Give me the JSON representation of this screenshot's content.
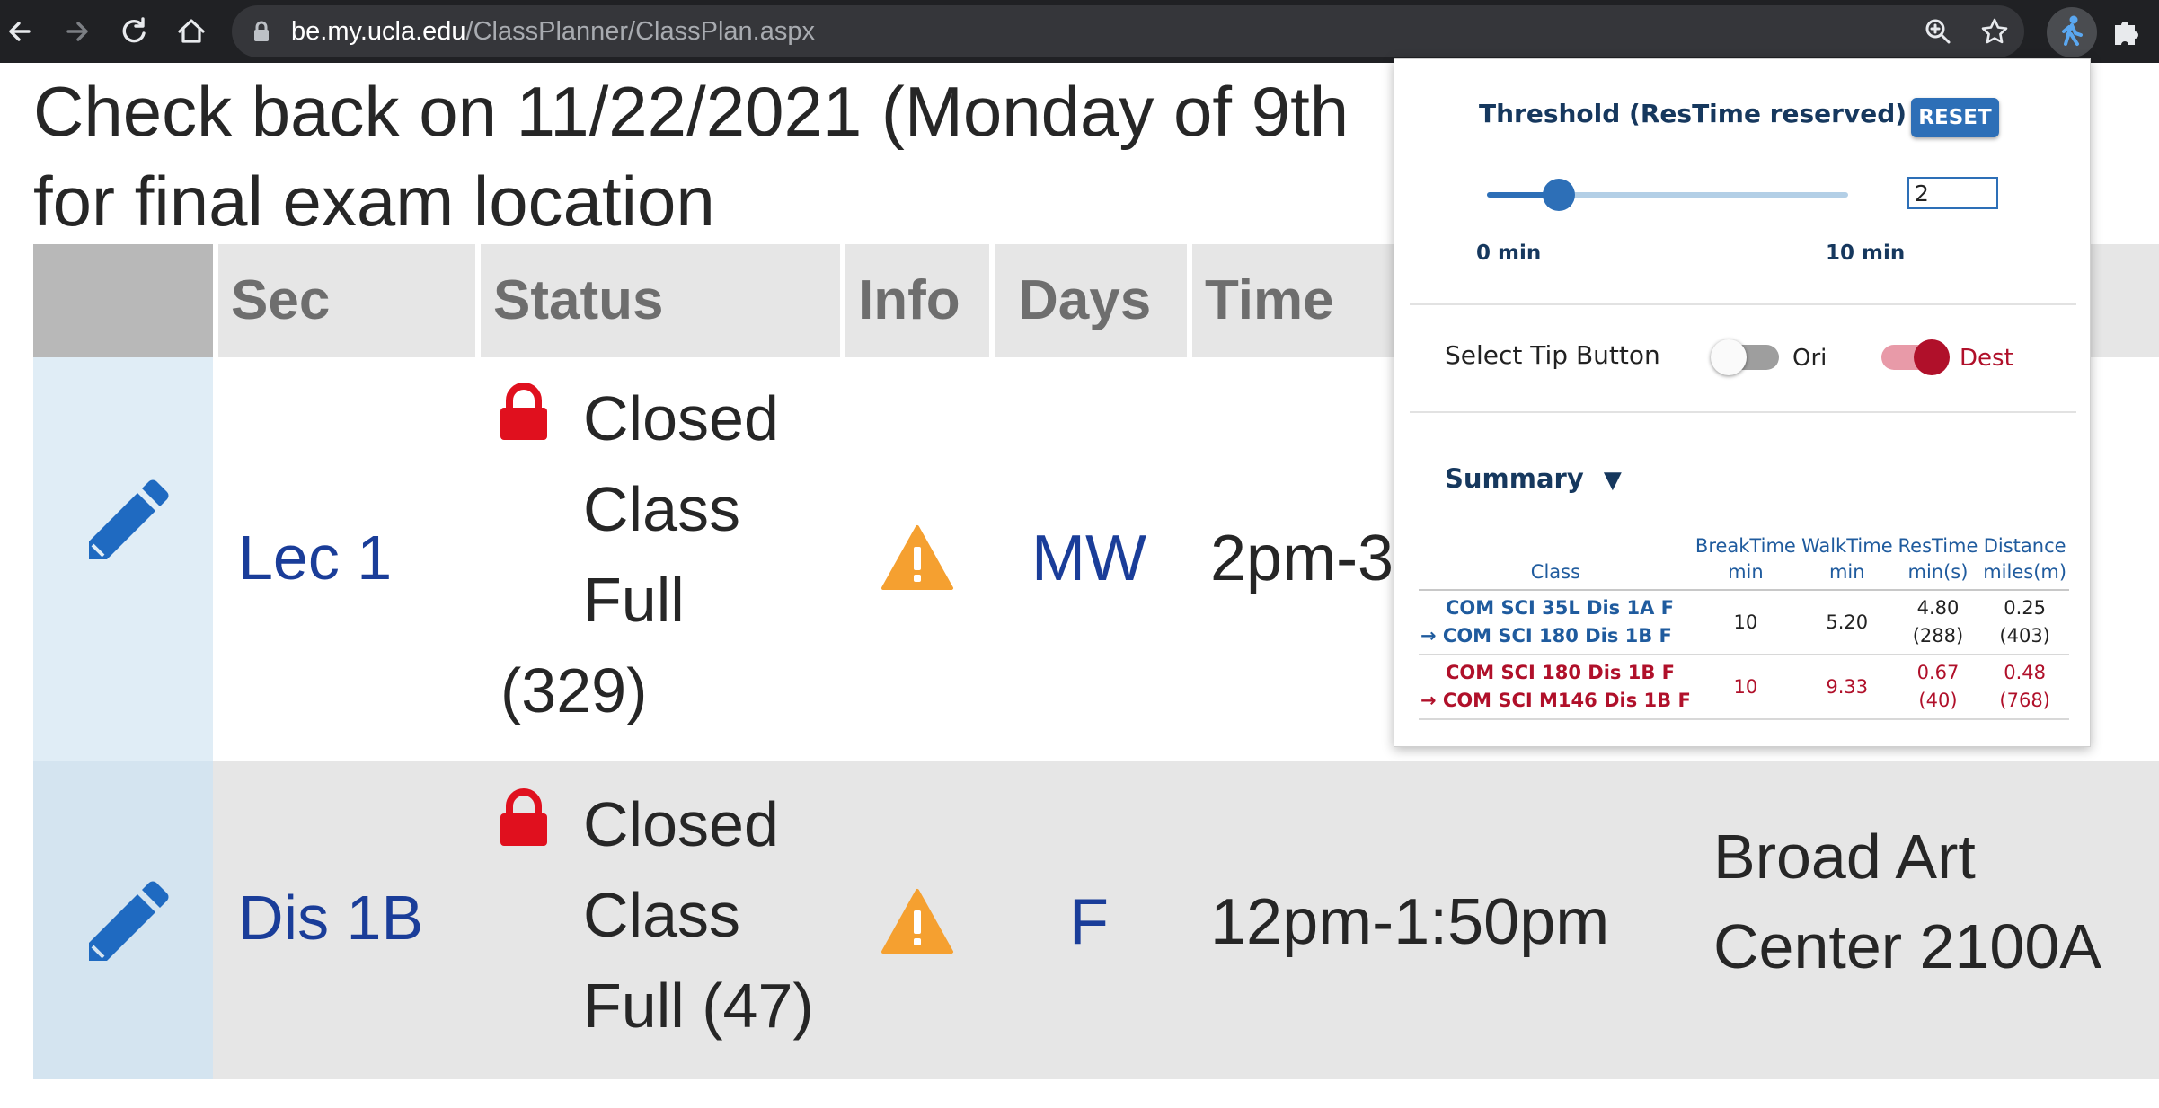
{
  "browser": {
    "url_host": "be.my.ucla.edu",
    "url_path": "/ClassPlanner/ClassPlan.aspx"
  },
  "page": {
    "headline_line1": "Check back on 11/22/2021 (Monday of 9th",
    "headline_line2": "for final exam location",
    "columns": [
      "",
      "Sec",
      "Status",
      "Info",
      "Days",
      "Time"
    ],
    "rows": [
      {
        "sec": "Lec 1",
        "status_lines": [
          "Closed",
          "Class",
          "Full",
          "(329)"
        ],
        "days": "MW",
        "time": "2pm-3",
        "location_lines": []
      },
      {
        "sec": "Dis 1B",
        "status_lines": [
          "Closed",
          "Class",
          "Full (47)"
        ],
        "days": "F",
        "time": "12pm-1:50pm",
        "location_lines": [
          "Broad Art",
          "Center 2100A"
        ]
      }
    ]
  },
  "popup": {
    "threshold_title": "Threshold (ResTime reserved)",
    "reset_label": "RESET",
    "threshold_value": "2",
    "slider_min_label": "0 min",
    "slider_max_label": "10 min",
    "slider_level": 0.2,
    "tip_label": "Select Tip Button",
    "ori_label": "Ori",
    "dest_label": "Dest",
    "ori_on": false,
    "dest_on": true,
    "summary_title": "Summary",
    "summary_toggle": "▼",
    "table": {
      "headers": [
        {
          "l1": "",
          "l2": "Class"
        },
        {
          "l1": "BreakTime",
          "l2": "min"
        },
        {
          "l1": "WalkTime",
          "l2": "min"
        },
        {
          "l1": "ResTime",
          "l2": "min(s)"
        },
        {
          "l1": "Distance",
          "l2": "miles(m)"
        }
      ],
      "rows": [
        {
          "from": "COM SCI 35L Dis 1A F",
          "to": "→ COM SCI 180 Dis 1B F",
          "break": "10",
          "walk": "5.20",
          "res": "4.80",
          "res_sec": "(288)",
          "dist": "0.25",
          "dist_m": "(403)"
        },
        {
          "from": "COM SCI 180 Dis 1B F",
          "to": "→ COM SCI M146 Dis 1B F",
          "break": "10",
          "walk": "9.33",
          "res": "0.67",
          "res_sec": "(40)",
          "dist": "0.48",
          "dist_m": "(768)"
        }
      ]
    }
  },
  "colors": {
    "link_blue": "#1a3d99",
    "popup_navy": "#16385e",
    "accent_blue": "#2d6fb7",
    "warning_orange": "#f5a030",
    "lock_red": "#e0101e",
    "danger_red": "#b0102a"
  }
}
